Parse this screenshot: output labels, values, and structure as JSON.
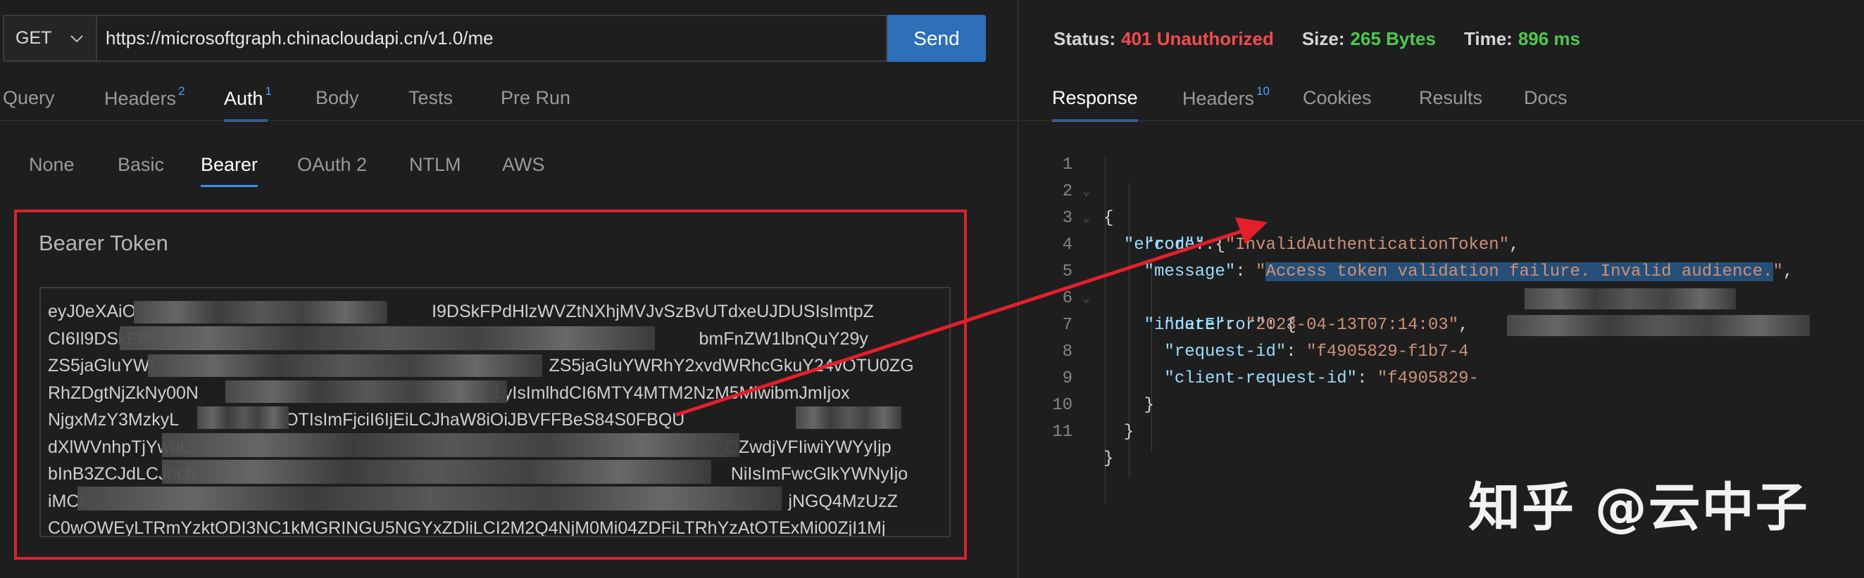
{
  "request": {
    "method": "GET",
    "url": "https://microsoftgraph.chinacloudapi.cn/v1.0/me",
    "send_label": "Send"
  },
  "request_tabs": [
    {
      "label": "Query",
      "badge": ""
    },
    {
      "label": "Headers",
      "badge": "2"
    },
    {
      "label": "Auth",
      "badge": "1",
      "active": true
    },
    {
      "label": "Body",
      "badge": ""
    },
    {
      "label": "Tests",
      "badge": ""
    },
    {
      "label": "Pre Run",
      "badge": ""
    }
  ],
  "auth_tabs": [
    {
      "label": "None"
    },
    {
      "label": "Basic"
    },
    {
      "label": "Bearer",
      "active": true
    },
    {
      "label": "OAuth 2"
    },
    {
      "label": "NTLM"
    },
    {
      "label": "AWS"
    }
  ],
  "bearer": {
    "title": "Bearer Token",
    "lines": [
      "eyJ0eXAiO",
      "CI6Il9DSkFP",
      "ZS5jaGluYWI",
      "RhZDgtNjZkNy00N",
      "NjgxMzY3MzkyL",
      "dXlWVnhpTjYwbL",
      "bInB3ZCJdLCJhcb",
      "iMCI",
      "C0wOWEyLTRmYzktODI3NC1kMGRINGU5NGYxZDliLCI2M2Q4NjM0Mi04ZDFiLTRhYzAtOTExMi00ZjI1Mj"
    ],
    "line_tails": [
      "I9DSkFPdHlzWVZtNXhjMVJvSzBvUTdxeUJDUSIsImtpZ",
      "bmFnZW1lbnQuY29y",
      "ZS5jaGluYWRhY2xvdWRhcGkuY24vOTU0ZG",
      "LyIsImlhdCI6MTY4MTM2NzM5MiwibmJmIjox",
      "OTIsImFjciI6IjEiLCJhaW8iOiJBVFFBeS84S0FBQU",
      "OZwdjVFIiwiYWYyIjp",
      "NiIsImFwcGlkYWNyIjo",
      "jNGQ4MzUzZ",
      ""
    ]
  },
  "status": {
    "status_label": "Status:",
    "status_value": "401 Unauthorized",
    "size_label": "Size:",
    "size_value": "265 Bytes",
    "time_label": "Time:",
    "time_value": "896 ms",
    "error_color": "#f14c4c",
    "ok_color": "#4ec94e"
  },
  "response_tabs": [
    {
      "label": "Response",
      "badge": "",
      "active": true
    },
    {
      "label": "Headers",
      "badge": "10"
    },
    {
      "label": "Cookies",
      "badge": ""
    },
    {
      "label": "Results",
      "badge": ""
    },
    {
      "label": "Docs",
      "badge": ""
    }
  ],
  "response_body": {
    "line_numbers": [
      "1",
      "2",
      "3",
      "4",
      "5",
      "6",
      "7",
      "8",
      "9",
      "10",
      "11"
    ],
    "code": "InvalidAuthenticationToken",
    "message": "Access token validation failure. Invalid audience.",
    "date": "2023-04-13T07:14:03",
    "request_id": "f4905829-f1b7-4",
    "client_request_id": "f4905829-"
  },
  "watermark": "知乎 @云中子",
  "colors": {
    "accent": "#3d8ee6",
    "send_button": "#2d6fb8",
    "annotation_red": "#d9232f"
  }
}
